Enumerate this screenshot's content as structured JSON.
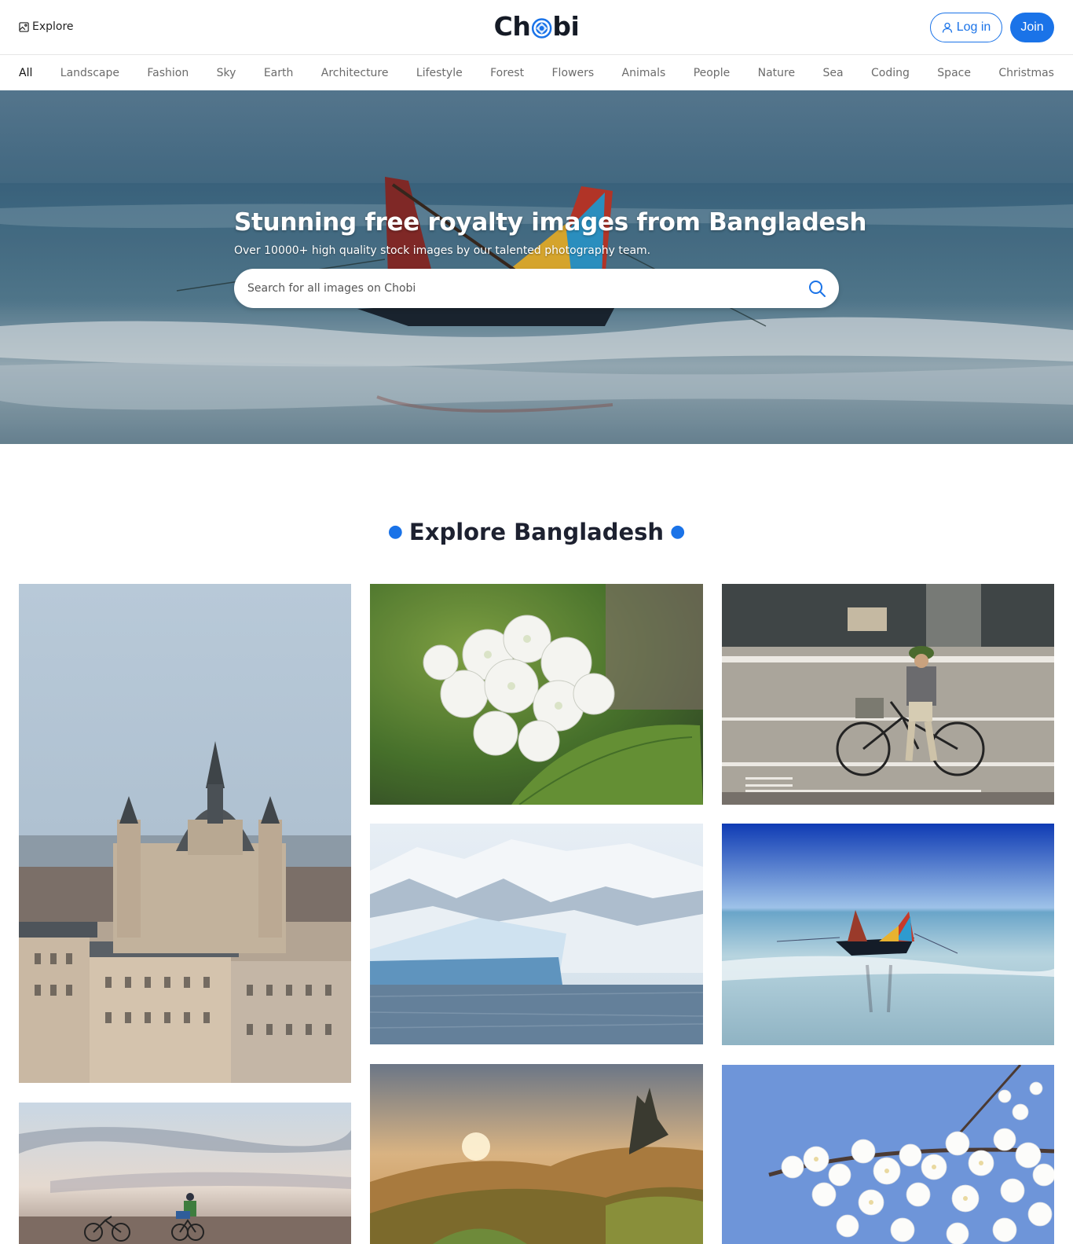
{
  "header": {
    "explore_label": "Explore",
    "logo_text_before": "Ch",
    "logo_text_after": "bi",
    "login_label": "Log in",
    "join_label": "Join"
  },
  "categories": [
    "All",
    "Landscape",
    "Fashion",
    "Sky",
    "Earth",
    "Architecture",
    "Lifestyle",
    "Forest",
    "Flowers",
    "Animals",
    "People",
    "Nature",
    "Sea",
    "Coding",
    "Space",
    "Christmas"
  ],
  "active_category": "All",
  "hero": {
    "title": "Stunning free royalty images from Bangladesh",
    "subtitle": "Over 10000+ high quality stock images by our talented photography team.",
    "search_placeholder": "Search for all images on Chobi"
  },
  "section": {
    "title": "Explore Bangladesh"
  },
  "gallery": [
    {
      "subject": "cathedral-city"
    },
    {
      "subject": "beach-cyclists"
    },
    {
      "subject": "white-hydrangea"
    },
    {
      "subject": "glacier-mountains"
    },
    {
      "subject": "highland-landscape"
    },
    {
      "subject": "street-cyclist"
    },
    {
      "subject": "boat-on-sea"
    },
    {
      "subject": "cherry-blossom"
    }
  ],
  "colors": {
    "accent": "#1a73e8",
    "text_dark": "#1d2130",
    "nav_text": "#6b6b6b"
  }
}
